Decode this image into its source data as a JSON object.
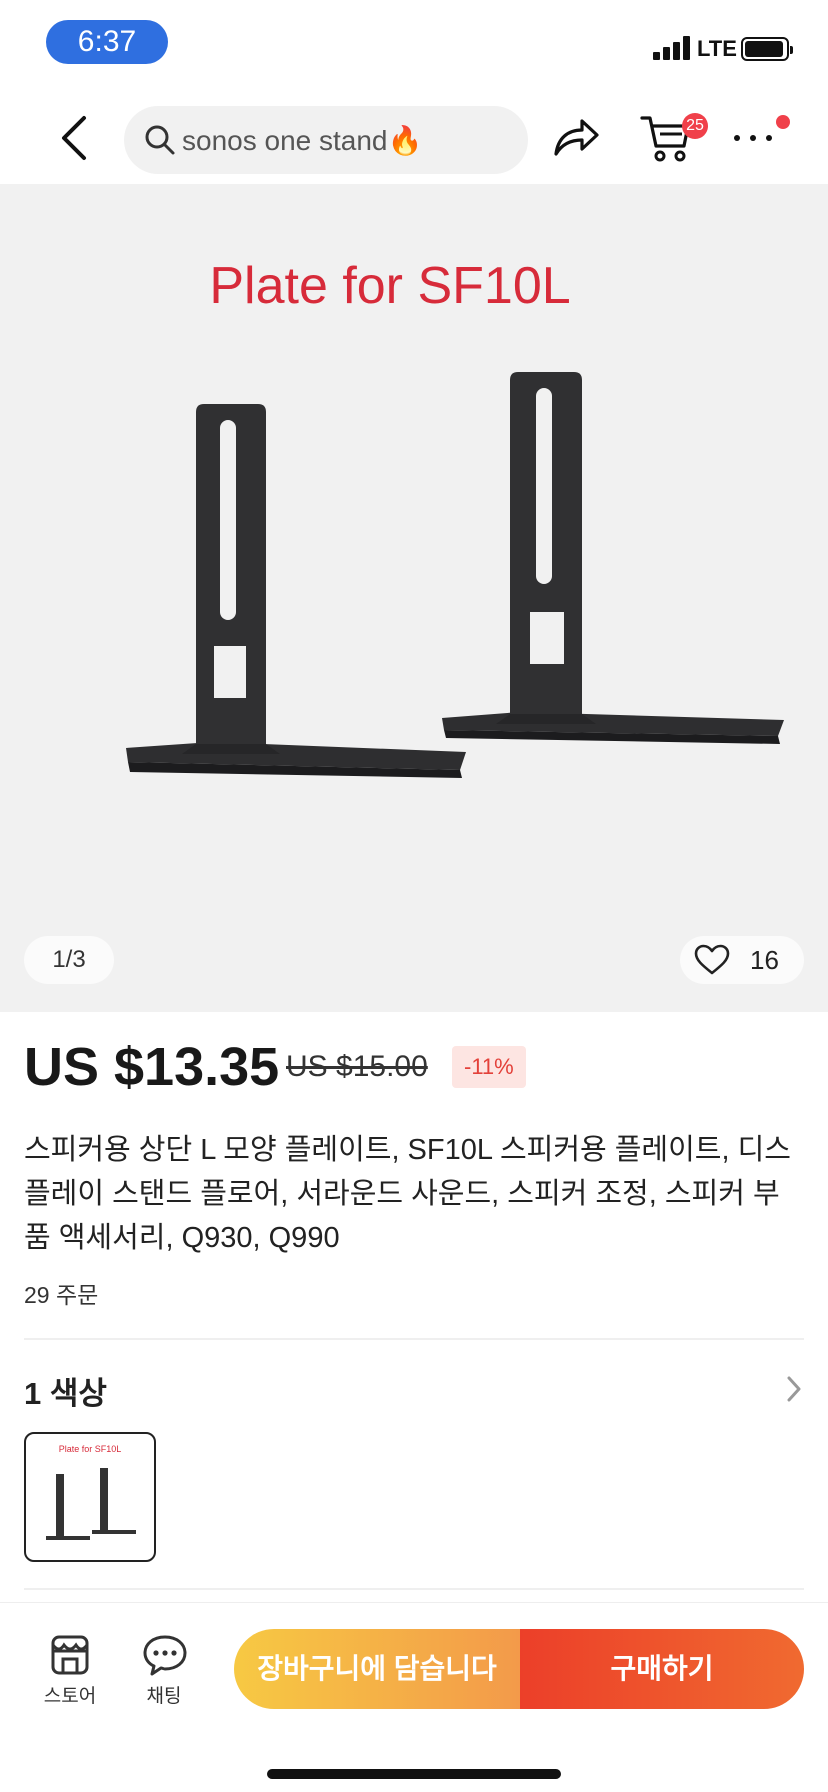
{
  "status_bar": {
    "time": "6:37",
    "network": "LTE"
  },
  "nav": {
    "search_text": "sonos one stand🔥",
    "cart_count": "25",
    "icons": [
      "back-icon",
      "search-icon",
      "share-icon",
      "cart-icon",
      "more-icon"
    ]
  },
  "gallery": {
    "image_title": "Plate for SF10L",
    "page_indicator": "1/3",
    "like_count": "16"
  },
  "product": {
    "price_current": "US $13.35",
    "price_original": "US $15.00",
    "discount": "-11%",
    "title": "스피커용 상단 L 모양 플레이트, SF10L 스피커용 플레이트, 디스플레이 스탠드 플로어, 서라운드 사운드, 스피커 조정, 스피커 부품 액세서리, Q930, Q990",
    "orders": "29 주문"
  },
  "variants": {
    "header": "1 색상",
    "thumb_title": "Plate for SF10L"
  },
  "bottom_bar": {
    "store_label": "스토어",
    "chat_label": "채팅",
    "add_to_cart_label": "장바구니에 담습니다",
    "buy_label": "구매하기"
  },
  "colors": {
    "accent_red": "#e3413a",
    "cart_gradient_start": "#f7c943",
    "buy_gradient_start": "#ec3f29",
    "badge": "#f0404a"
  }
}
